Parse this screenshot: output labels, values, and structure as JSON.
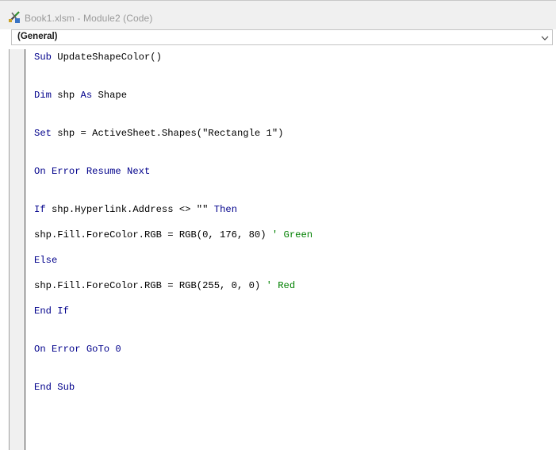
{
  "window": {
    "title": "Book1.xlsm - Module2 (Code)"
  },
  "object_dropdown": {
    "selected": "(General)"
  },
  "code_lines": [
    {
      "tokens": [
        {
          "t": "Sub",
          "k": "kw"
        },
        {
          "t": " UpdateShapeColor()"
        }
      ]
    },
    {
      "tokens": [
        {
          "t": "Dim",
          "k": "kw"
        },
        {
          "t": " shp "
        },
        {
          "t": "As",
          "k": "kw"
        },
        {
          "t": " Shape"
        }
      ]
    },
    {
      "tokens": [
        {
          "t": "Set",
          "k": "kw"
        },
        {
          "t": " shp = ActiveSheet.Shapes(\"Rectangle 1\")"
        }
      ]
    },
    {
      "tokens": [
        {
          "t": "On Error Resume Next",
          "k": "kw"
        }
      ]
    },
    {
      "tokens": [
        {
          "t": "If",
          "k": "kw"
        },
        {
          "t": " shp.Hyperlink.Address <> \"\" "
        },
        {
          "t": "Then",
          "k": "kw"
        }
      ]
    },
    {
      "tokens": [
        {
          "t": "shp.Fill.ForeColor.RGB = RGB(0, 176, 80) "
        },
        {
          "t": "' Green",
          "k": "cmt"
        }
      ]
    },
    {
      "tokens": [
        {
          "t": "Else",
          "k": "kw"
        }
      ]
    },
    {
      "tokens": [
        {
          "t": "shp.Fill.ForeColor.RGB = RGB(255, 0, 0) "
        },
        {
          "t": "' Red",
          "k": "cmt"
        }
      ]
    },
    {
      "tokens": [
        {
          "t": "End If",
          "k": "kw"
        }
      ]
    },
    {
      "tokens": [
        {
          "t": "On Error GoTo 0",
          "k": "kw"
        }
      ]
    },
    {
      "tokens": [
        {
          "t": "End Sub",
          "k": "kw"
        }
      ]
    }
  ],
  "colors": {
    "keyword": "#00008b",
    "comment": "#008000",
    "text": "#000000"
  }
}
